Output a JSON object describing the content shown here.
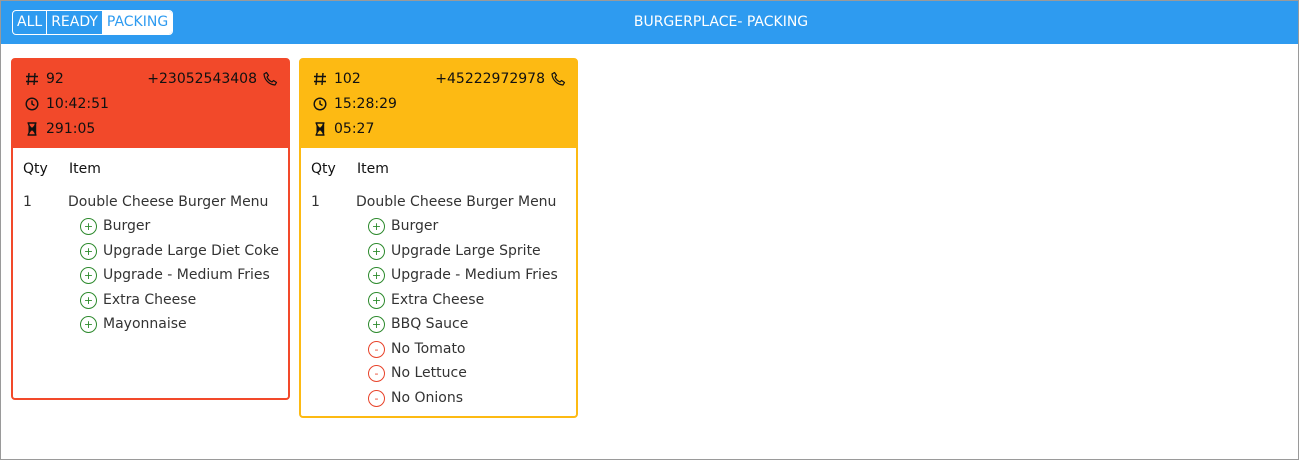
{
  "header": {
    "tabs": [
      {
        "label": "ALL",
        "active": false
      },
      {
        "label": "READY",
        "active": false
      },
      {
        "label": "PACKING",
        "active": true
      }
    ],
    "title": "BURGERPLACE- PACKING",
    "color": "#2e9bf0"
  },
  "columns": {
    "qty": "Qty",
    "item": "Item"
  },
  "orders": [
    {
      "number": "92",
      "phone": "+23052543408",
      "time": "10:42:51",
      "elapsed": "291:05",
      "status_color": "#f2492a",
      "line": {
        "qty": "1",
        "name": "Double Cheese Burger Menu",
        "modifiers": [
          {
            "sign": "+",
            "type": "add",
            "label": "Burger"
          },
          {
            "sign": "+",
            "type": "add",
            "label": "Upgrade Large Diet Coke"
          },
          {
            "sign": "+",
            "type": "add",
            "label": "Upgrade - Medium Fries"
          },
          {
            "sign": "+",
            "type": "add",
            "label": "Extra Cheese"
          },
          {
            "sign": "+",
            "type": "add",
            "label": "Mayonnaise"
          }
        ]
      }
    },
    {
      "number": "102",
      "phone": "+45222972978",
      "time": "15:28:29",
      "elapsed": "05:27",
      "status_color": "#fdba13",
      "line": {
        "qty": "1",
        "name": "Double Cheese Burger Menu",
        "modifiers": [
          {
            "sign": "+",
            "type": "add",
            "label": "Burger"
          },
          {
            "sign": "+",
            "type": "add",
            "label": "Upgrade Large Sprite"
          },
          {
            "sign": "+",
            "type": "add",
            "label": "Upgrade - Medium Fries"
          },
          {
            "sign": "+",
            "type": "add",
            "label": "Extra Cheese"
          },
          {
            "sign": "+",
            "type": "add",
            "label": "BBQ Sauce"
          },
          {
            "sign": "-",
            "type": "remove",
            "label": "No Tomato"
          },
          {
            "sign": "-",
            "type": "remove",
            "label": "No Lettuce"
          },
          {
            "sign": "-",
            "type": "remove",
            "label": "No Onions"
          }
        ]
      }
    }
  ]
}
